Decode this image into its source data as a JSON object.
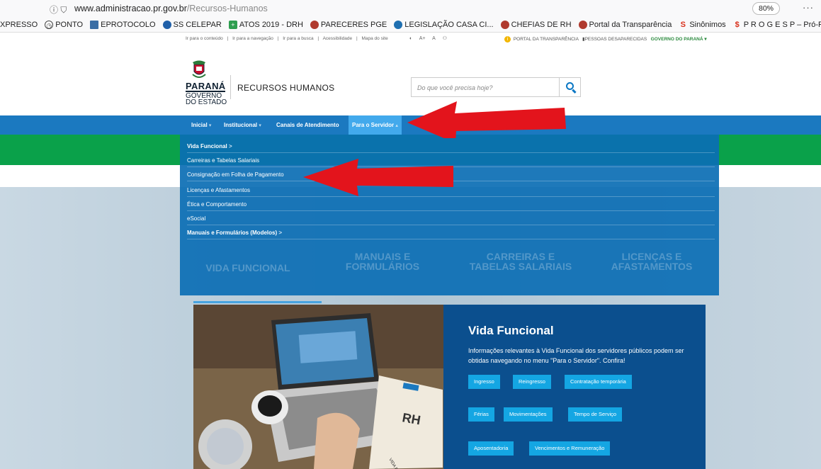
{
  "browser": {
    "url_icons": "ⓘ ⛉",
    "url_domain": "www.administracao.pr.gov.br",
    "url_path": "/Recursos-Humanos",
    "zoom": "80%",
    "more": "···"
  },
  "bookmarks": [
    {
      "label": "XPRESSO",
      "color": "#777"
    },
    {
      "label": "PONTO",
      "color": "#444"
    },
    {
      "label": "EPROTOCOLO",
      "color": "#3a6ea5"
    },
    {
      "label": "SS CELEPAR",
      "color": "#1f5fa8"
    },
    {
      "label": "ATOS 2019 - DRH",
      "color": "#2e9e4f"
    },
    {
      "label": "PARECERES PGE",
      "color": "#b03a2e"
    },
    {
      "label": "LEGISLAÇÃO CASA CI...",
      "color": "#1f6fb0"
    },
    {
      "label": "CHEFIAS DE RH",
      "color": "#b03a2e"
    },
    {
      "label": "Portal da Transparência",
      "color": "#b03a2e"
    },
    {
      "label": "Sinônimos",
      "color": "#d9301c"
    },
    {
      "label": "P R O G E S P – Pró-Rei...",
      "color": "#d9301c"
    }
  ],
  "accessibility": {
    "links": [
      "Ir para o conteúdo",
      "|",
      "Ir para a navegação",
      "|",
      "Ir para a busca",
      "|",
      "Acessibilidade",
      "|",
      "Mapa do site"
    ],
    "font_controls": [
      "◐",
      "A+",
      "A",
      "⚇"
    ],
    "portal_transparencia": "PORTAL DA TRANSPARÊNCIA",
    "pessoas": "PESSOAS DESAPARECIDAS",
    "governo": "GOVERNO DO PARANÁ ▾"
  },
  "header": {
    "logo_parana": "PARANÁ",
    "logo_governo": "GOVERNO",
    "logo_estado": "DO ESTADO",
    "site_name": "RECURSOS HUMANOS",
    "search_placeholder": "Do que você precisa hoje?"
  },
  "nav": {
    "items": [
      {
        "label": "Inicial",
        "caret": "▾"
      },
      {
        "label": "Institucional",
        "caret": "▾"
      },
      {
        "label": "Canais de Atendimento",
        "caret": ""
      },
      {
        "label": "Para o Servidor",
        "caret": "▴"
      }
    ]
  },
  "dropdown": {
    "items": [
      {
        "label": "Vida Funcional",
        "chev": ">"
      },
      {
        "label": "Carreiras e Tabelas Salariais",
        "chev": ""
      },
      {
        "label": "Consignação em Folha de Pagamento",
        "chev": ""
      },
      {
        "label": "Licenças e Afastamentos",
        "chev": ""
      },
      {
        "label": "Ética e Comportamento",
        "chev": ""
      },
      {
        "label": "eSocial",
        "chev": ""
      },
      {
        "label": "Manuais e Formulários (Modelos)",
        "chev": ">"
      }
    ]
  },
  "cards": [
    {
      "line1": "",
      "line2": "VIDA FUNCIONAL"
    },
    {
      "line1": "MANUAIS E",
      "line2": "FORMULÁRIOS"
    },
    {
      "line1": "CARREIRAS E",
      "line2": "TABELAS SALARIAIS"
    },
    {
      "line1": "LICENÇAS E",
      "line2": "AFASTAMENTOS"
    }
  ],
  "vida_funcional": {
    "title": "Vida Funcional",
    "description": "Informações relevantes à Vida Funcional dos servidores públicos podem ser obtidas navegando no menu \"Para o Servidor\". Confira!",
    "buttons": [
      "Ingresso",
      "Reingresso",
      "Contratação temporária",
      "Férias",
      "Movimentações",
      "Tempo de Serviço",
      "Aposentadoria",
      "Vencimentos e Remuneração"
    ]
  },
  "laptop_image": {
    "notebook_brand": "RH",
    "notebook_caption": "VIDA FUNCIONAL"
  },
  "colors": {
    "nav_blue": "#1b79c0",
    "active_tab": "#42a9ec",
    "green_band": "#0aa14a",
    "dropdown_blue": "#0b6eb4",
    "panel_blue": "#0b4f8e",
    "button_cyan": "#14a6e3",
    "arrow_red": "#e3141c"
  }
}
